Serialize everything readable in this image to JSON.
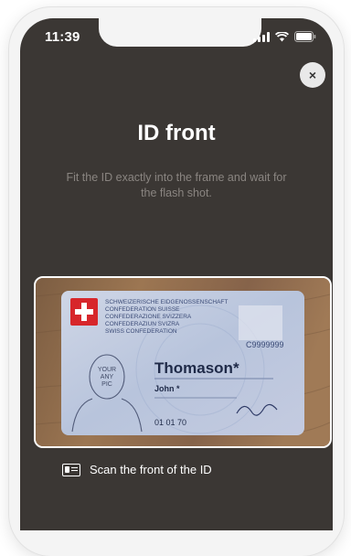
{
  "status_bar": {
    "time": "11:39"
  },
  "close_button": {
    "label": "×"
  },
  "title": "ID front",
  "subtitle": "Fit the ID exactly into the frame and wait for the flash shot.",
  "id_card": {
    "header_lines": [
      "SCHWEIZERISCHE EIDGENOSSENSCHAFT",
      "CONFEDERATION SUISSE",
      "CONFEDERAZIONE SVIZZERA",
      "CONFEDERAZIUN SVIZRA",
      "SWISS CONFEDERATION"
    ],
    "card_number": "C9999999",
    "surname": "Thomason*",
    "given_name": "John *",
    "photo_placeholder": [
      "YOUR",
      "ANY",
      "PIC"
    ],
    "birth_date": "01 01 70"
  },
  "scan_hint": {
    "label": "Scan the front of the ID"
  },
  "colors": {
    "background": "#3b3734",
    "accent_text": "#ffffff",
    "muted_text": "#8a8581"
  }
}
